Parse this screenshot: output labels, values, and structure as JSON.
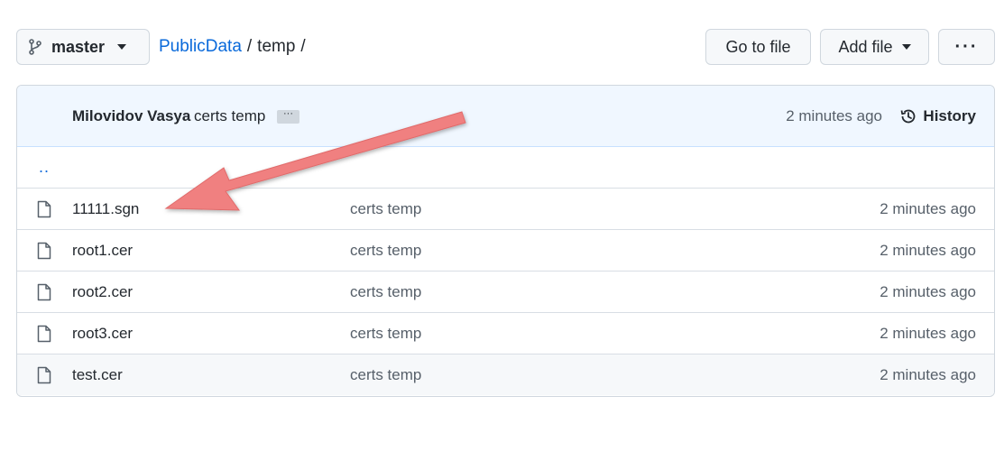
{
  "branch": {
    "name": "master"
  },
  "breadcrumb": {
    "repo": "PublicData",
    "separator": "/",
    "folder": "temp",
    "trailing": "/"
  },
  "actions": {
    "goto_label": "Go to file",
    "add_label": "Add file",
    "more_label": "···"
  },
  "commit": {
    "author": "Milovidov Vasya",
    "message": "certs temp",
    "ellipsis": "···",
    "time": "2 minutes ago",
    "history_label": "History"
  },
  "parent_dir": "..",
  "files": [
    {
      "name": "11111.sgn",
      "commit": "certs temp",
      "time": "2 minutes ago"
    },
    {
      "name": "root1.cer",
      "commit": "certs temp",
      "time": "2 minutes ago"
    },
    {
      "name": "root2.cer",
      "commit": "certs temp",
      "time": "2 minutes ago"
    },
    {
      "name": "root3.cer",
      "commit": "certs temp",
      "time": "2 minutes ago"
    },
    {
      "name": "test.cer",
      "commit": "certs temp",
      "time": "2 minutes ago"
    }
  ],
  "colors": {
    "link": "#0969da",
    "annotation_arrow": "#f08080",
    "commit_bar": "#f0f7ff"
  }
}
